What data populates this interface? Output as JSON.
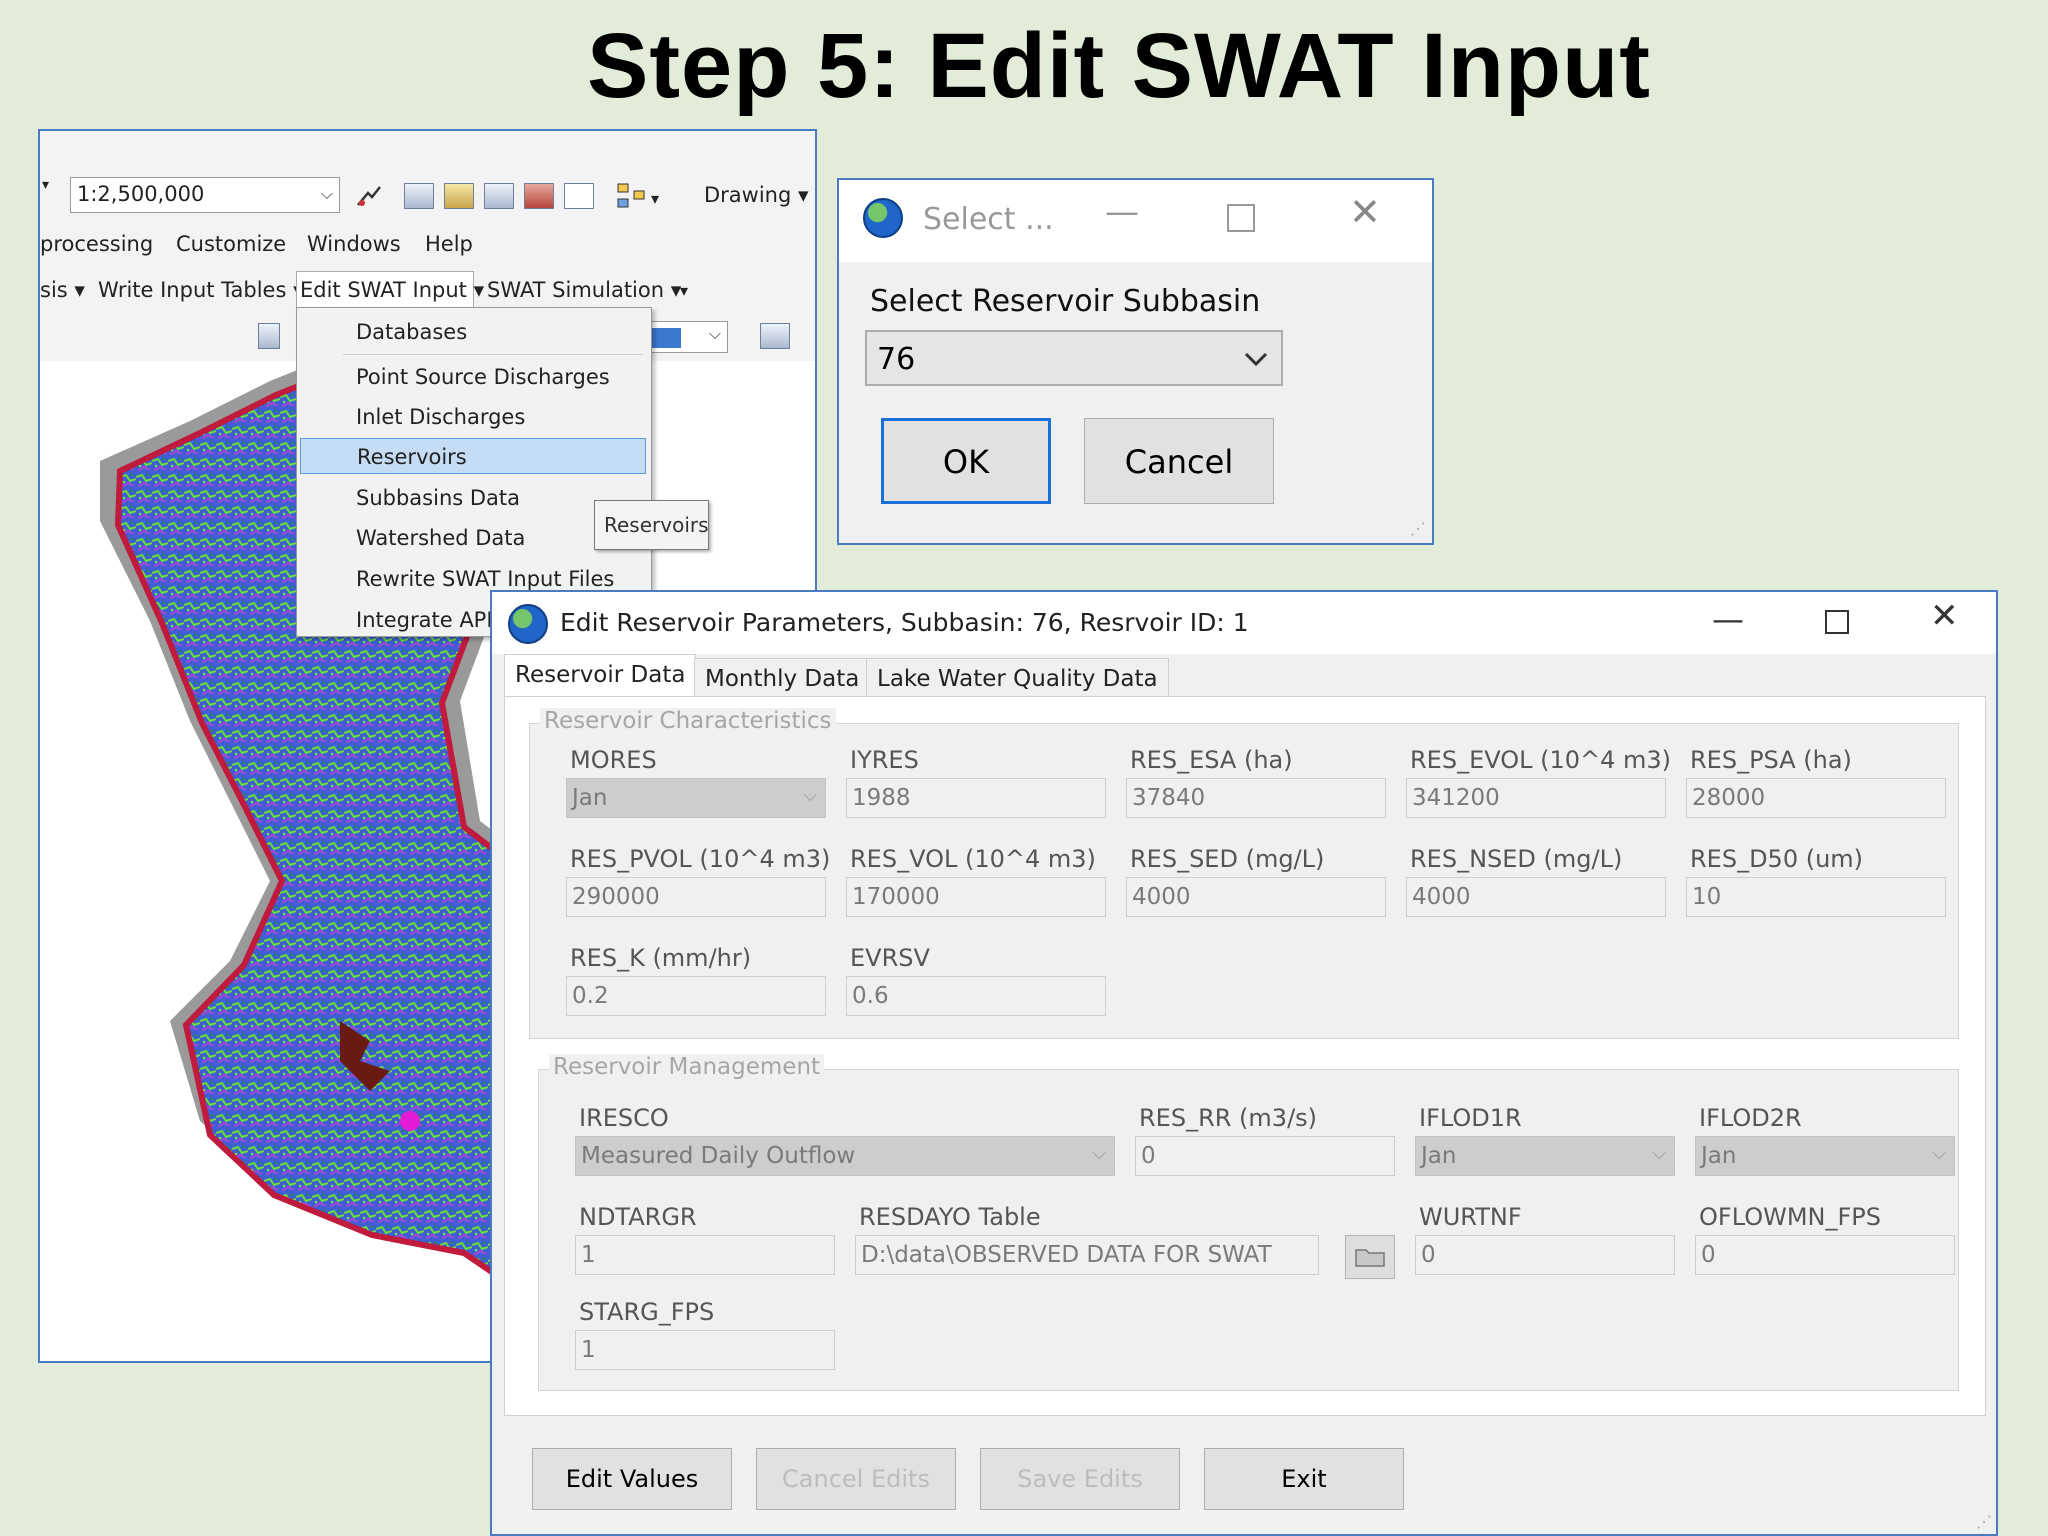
{
  "slide": {
    "title": "Step 5: Edit SWAT Input"
  },
  "arcmap": {
    "scale_value": "1:2,500,000",
    "drawing_label": "Drawing",
    "menubar": [
      "processing",
      "Customize",
      "Windows",
      "Help"
    ],
    "swat_toolbar": [
      "sis",
      "Write Input Tables",
      "Edit SWAT Input",
      "SWAT Simulation"
    ],
    "menu_items": [
      "Databases",
      "Point Source Discharges",
      "Inlet Discharges",
      "Reservoirs",
      "Subbasins Data",
      "Watershed Data",
      "Rewrite SWAT Input Files",
      "Integrate APEX"
    ],
    "selected_item": "Reservoirs",
    "tooltip": "Reservoirs"
  },
  "select_dialog": {
    "title": "Select ...",
    "label": "Select Reservoir Subbasin",
    "value": "76",
    "ok": "OK",
    "cancel": "Cancel"
  },
  "edit_window": {
    "title": "Edit Reservoir Parameters, Subbasin: 76, Resrvoir ID:  1",
    "tabs": [
      "Reservoir Data",
      "Monthly Data",
      "Lake Water Quality Data"
    ],
    "characteristics": {
      "legend": "Reservoir Characteristics",
      "labels": [
        "MORES",
        "IYRES",
        "RES_ESA (ha)",
        "RES_EVOL (10^4 m3)",
        "RES_PSA (ha)",
        "RES_PVOL (10^4 m3)",
        "RES_VOL (10^4 m3)",
        "RES_SED (mg/L)",
        "RES_NSED (mg/L)",
        "RES_D50 (um)",
        "RES_K (mm/hr)",
        "EVRSV"
      ],
      "values": [
        "Jan",
        "1988",
        "37840",
        "341200",
        "28000",
        "290000",
        "170000",
        "4000",
        "4000",
        "10",
        "0.2",
        "0.6"
      ]
    },
    "management": {
      "legend": "Reservoir Management",
      "labels": [
        "IRESCO",
        "RES_RR (m3/s)",
        "IFLOD1R",
        "IFLOD2R",
        "NDTARGR",
        "RESDAYO Table",
        "WURTNF",
        "OFLOWMN_FPS",
        "STARG_FPS"
      ],
      "values": [
        "Measured Daily Outflow",
        "0",
        "Jan",
        "Jan",
        "1",
        "D:\\data\\OBSERVED DATA FOR SWAT",
        "0",
        "0",
        "1"
      ]
    },
    "buttons": {
      "edit": "Edit Values",
      "cancel_edits": "Cancel Edits",
      "save_edits": "Save Edits",
      "exit": "Exit"
    }
  }
}
